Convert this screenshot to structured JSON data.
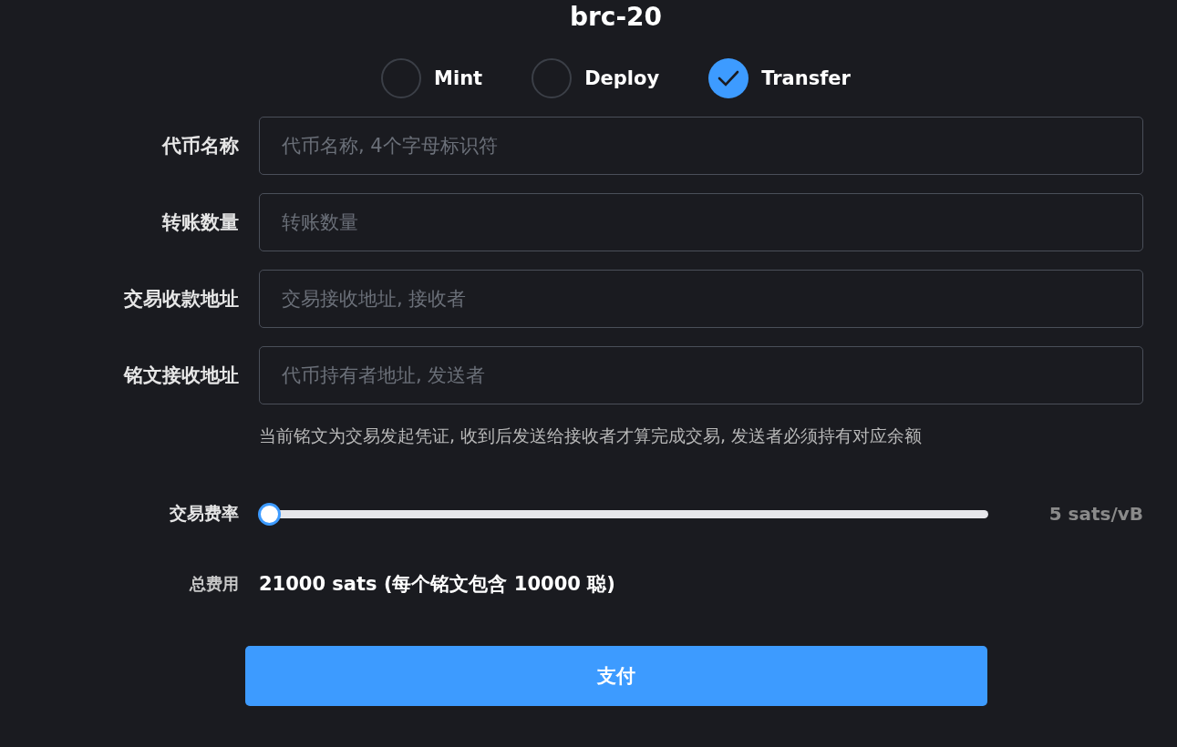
{
  "title": "brc-20",
  "options": [
    {
      "label": "Mint",
      "selected": false
    },
    {
      "label": "Deploy",
      "selected": false
    },
    {
      "label": "Transfer",
      "selected": true
    }
  ],
  "fields": [
    {
      "label": "代币名称",
      "placeholder": "代币名称, 4个字母标识符"
    },
    {
      "label": "转账数量",
      "placeholder": "转账数量"
    },
    {
      "label": "交易收款地址",
      "placeholder": "交易接收地址, 接收者"
    },
    {
      "label": "铭文接收地址",
      "placeholder": "代币持有者地址, 发送者"
    }
  ],
  "hint": "当前铭文为交易发起凭证, 收到后发送给接收者才算完成交易, 发送者必须持有对应余额",
  "fee_rate": {
    "label": "交易费率",
    "level": 0,
    "reading": "5 sats/vB"
  },
  "total": {
    "label": "总费用",
    "value": "21000 sats (每个铭文包含 10000 聪)"
  },
  "pay_button": "支付"
}
